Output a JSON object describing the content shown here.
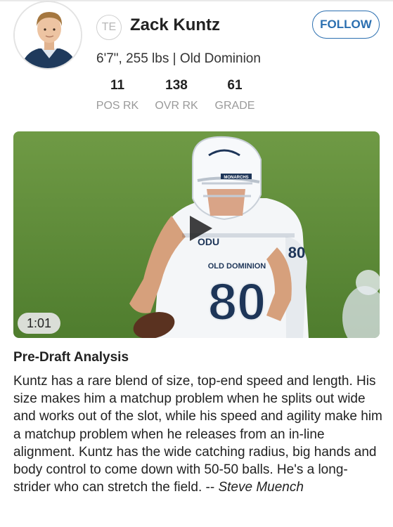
{
  "player": {
    "name": "Zack Kuntz",
    "position": "TE",
    "meta": "6'7\", 255 lbs | Old Dominion",
    "follow_label": "FOLLOW"
  },
  "stats": [
    {
      "value": "11",
      "label": "POS RK"
    },
    {
      "value": "138",
      "label": "OVR RK"
    },
    {
      "value": "61",
      "label": "GRADE"
    }
  ],
  "video": {
    "duration": "1:01",
    "jersey_number": "80",
    "sleeve_number": "80",
    "chest_text": "OLD DOMINION",
    "helmet_text": "MONARCHS",
    "collar_text": "ODU"
  },
  "analysis": {
    "title": "Pre-Draft Analysis",
    "body": "Kuntz has a rare blend of size, top-end speed and length. His size makes him a matchup problem when he splits out wide and works out of the slot, while his speed and agility make him a matchup problem when he releases from an in-line alignment. Kuntz has the wide catching radius, big hands and body control to come down with 50-50 balls. He's a long-strider who can stretch the field.",
    "separator": " -- ",
    "author": "Steve Muench"
  },
  "colors": {
    "accent": "#2b6fb0",
    "grass": "#5f8c37",
    "jersey_navy": "#1d3558"
  }
}
